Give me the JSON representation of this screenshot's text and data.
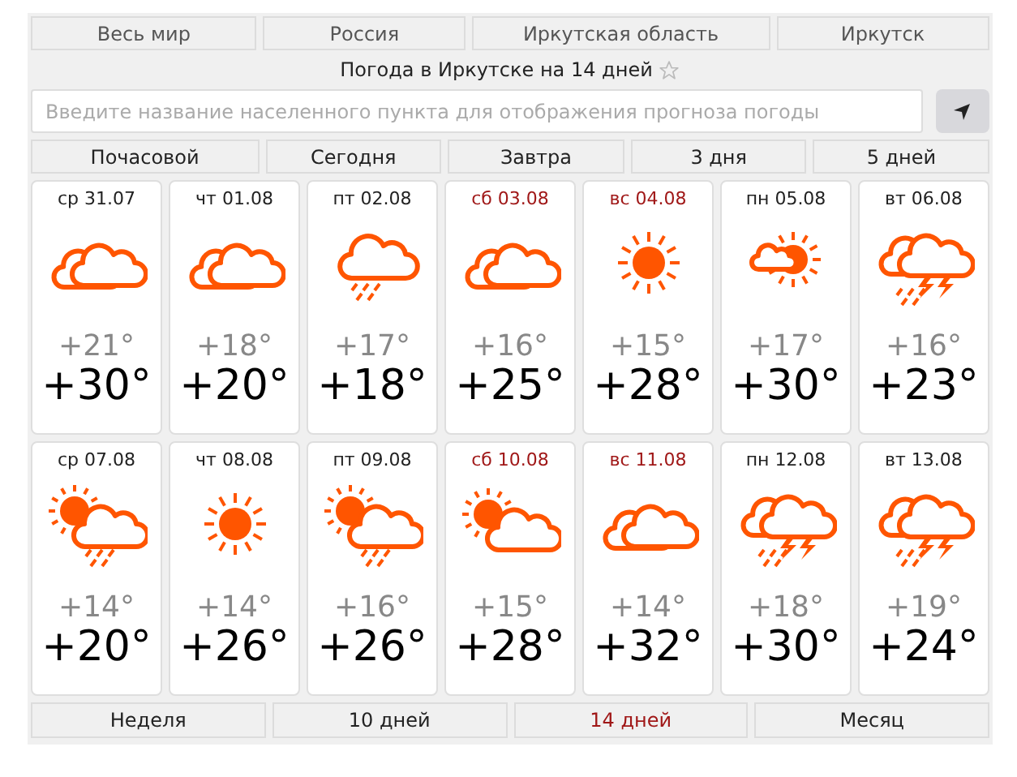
{
  "breadcrumbs": [
    "Весь мир",
    "Россия",
    "Иркутская область",
    "Иркутск"
  ],
  "title": "Погода в Иркутске на 14 дней",
  "favorite": {
    "on": false
  },
  "search": {
    "placeholder": "Введите название населенного пункта для отображения прогноза погоды"
  },
  "ranges": [
    {
      "label": "Почасовой"
    },
    {
      "label": "Сегодня"
    },
    {
      "label": "Завтра"
    },
    {
      "label": "3 дня"
    },
    {
      "label": "5 дней"
    }
  ],
  "days": [
    {
      "date": "ср 31.07",
      "weekend": false,
      "kind": "cloudy",
      "low": "+21°",
      "high": "+30°"
    },
    {
      "date": "чт 01.08",
      "weekend": false,
      "kind": "cloudy",
      "low": "+18°",
      "high": "+20°"
    },
    {
      "date": "пт 02.08",
      "weekend": false,
      "kind": "rain",
      "low": "+17°",
      "high": "+18°"
    },
    {
      "date": "сб 03.08",
      "weekend": true,
      "kind": "cloudy",
      "low": "+16°",
      "high": "+25°"
    },
    {
      "date": "вс 04.08",
      "weekend": true,
      "kind": "sun",
      "low": "+15°",
      "high": "+28°"
    },
    {
      "date": "пн 05.08",
      "weekend": false,
      "kind": "sun-small-cloud",
      "low": "+17°",
      "high": "+30°"
    },
    {
      "date": "вт 06.08",
      "weekend": false,
      "kind": "thunder",
      "low": "+16°",
      "high": "+23°"
    },
    {
      "date": "ср 07.08",
      "weekend": false,
      "kind": "sun-cloud-rain",
      "low": "+14°",
      "high": "+20°"
    },
    {
      "date": "чт 08.08",
      "weekend": false,
      "kind": "sun",
      "low": "+14°",
      "high": "+26°"
    },
    {
      "date": "пт 09.08",
      "weekend": false,
      "kind": "sun-cloud-rain",
      "low": "+16°",
      "high": "+26°"
    },
    {
      "date": "сб 10.08",
      "weekend": true,
      "kind": "sun-cloud",
      "low": "+15°",
      "high": "+28°"
    },
    {
      "date": "вс 11.08",
      "weekend": true,
      "kind": "cloudy",
      "low": "+14°",
      "high": "+32°"
    },
    {
      "date": "пн 12.08",
      "weekend": false,
      "kind": "thunder",
      "low": "+18°",
      "high": "+30°"
    },
    {
      "date": "вт 13.08",
      "weekend": false,
      "kind": "thunder",
      "low": "+19°",
      "high": "+24°"
    }
  ],
  "periods": [
    {
      "label": "Неделя",
      "selected": false
    },
    {
      "label": "10 дней",
      "selected": false
    },
    {
      "label": "14 дней",
      "selected": true
    },
    {
      "label": "Месяц",
      "selected": false
    }
  ]
}
